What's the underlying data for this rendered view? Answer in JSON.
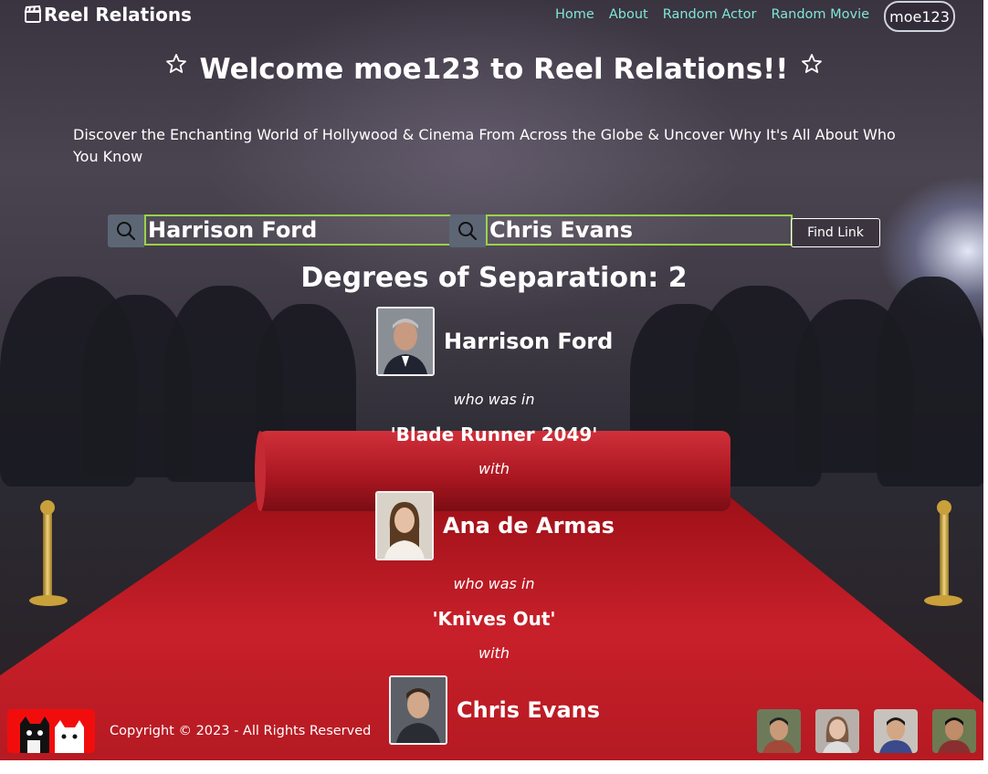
{
  "nav": {
    "brand": "Reel Relations",
    "links": [
      "Home",
      "About",
      "Random Actor",
      "Random Movie"
    ],
    "user": "moe123"
  },
  "header": {
    "welcome": "Welcome moe123 to Reel Relations!!",
    "tagline": "Discover the Enchanting World of Hollywood & Cinema From Across the Globe & Uncover Why It's All About Who You Know"
  },
  "search": {
    "actor1_value": "Harrison Ford",
    "actor2_value": "Chris Evans",
    "button_label": "Find Link"
  },
  "result": {
    "degrees_label": "Degrees of Separation: 2",
    "chain": [
      {
        "actor": "Harrison Ford"
      },
      {
        "connector": "who was in"
      },
      {
        "movie": "'Blade Runner 2049'"
      },
      {
        "connector": "with"
      },
      {
        "actor": "Ana de Armas"
      },
      {
        "connector": "who was in"
      },
      {
        "movie": "'Knives Out'"
      },
      {
        "connector": "with"
      },
      {
        "actor": "Chris Evans"
      }
    ]
  },
  "footer": {
    "copyright": "Copyright © 2023 - All Rights Reserved",
    "team_avatars": 4
  },
  "colors": {
    "nav_link": "#7fe7d8",
    "input_border": "#9bd24a",
    "footer_logo": "#f20d0d"
  }
}
